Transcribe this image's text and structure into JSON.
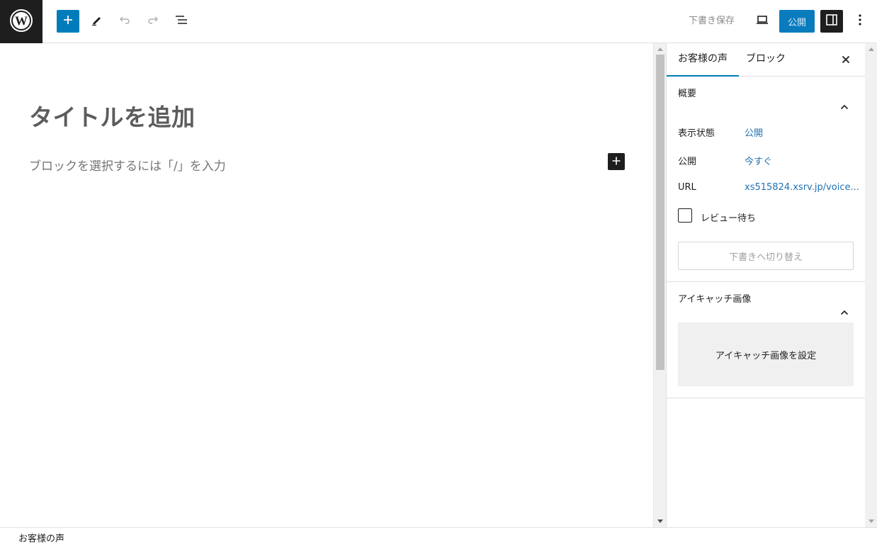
{
  "toolbar": {
    "logo_icon": "wordpress-logo-icon",
    "add_block_icon": "plus-icon",
    "tools_icon": "pencil-icon",
    "undo_icon": "undo-icon",
    "redo_icon": "redo-icon",
    "list_view_icon": "list-view-icon",
    "save_draft_label": "下書き保存",
    "preview_icon": "laptop-icon",
    "publish_label": "公開",
    "settings_icon": "sidebar-toggle-icon",
    "more_icon": "vertical-ellipsis-icon",
    "accent_color": "#007cba"
  },
  "editor": {
    "title_placeholder": "タイトルを追加",
    "block_placeholder": "ブロックを選択するには「/」を入力",
    "inline_add_icon": "plus-icon"
  },
  "sidebar": {
    "tabs": [
      {
        "label": "お客様の声",
        "active": true
      },
      {
        "label": "ブロック",
        "active": false
      }
    ],
    "close_icon": "close-icon",
    "summary": {
      "title": "概要",
      "rows": [
        {
          "label": "表示状態",
          "value": "公開"
        },
        {
          "label": "公開",
          "value": "今すぐ"
        },
        {
          "label": "URL",
          "value": "xs515824.xsrv.jp/voice..."
        }
      ],
      "pending_review_label": "レビュー待ち",
      "switch_to_draft_label": "下書きへ切り替え"
    },
    "featured_image": {
      "title": "アイキャッチ画像",
      "set_button_label": "アイキャッチ画像を設定"
    }
  },
  "footer": {
    "breadcrumb": "お客様の声"
  }
}
